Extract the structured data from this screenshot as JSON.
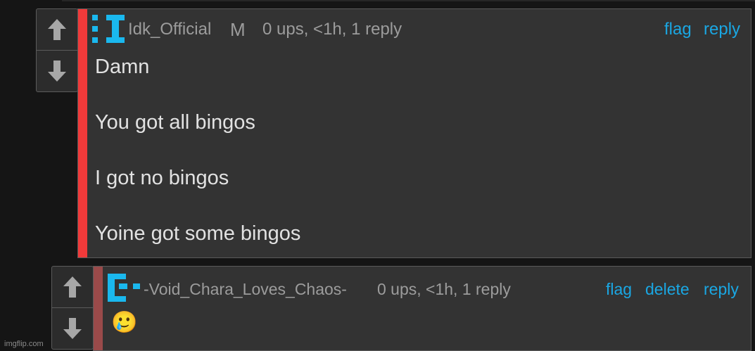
{
  "comments": [
    {
      "username": "Idk_Official",
      "badge": "M",
      "stats": "0 ups, <1h, 1 reply",
      "actions": {
        "flag": "flag",
        "reply": "reply"
      },
      "body": [
        "Damn",
        "You got all bingos",
        "I got no bingos",
        "Yoine got some bingos"
      ],
      "accent_color": "#f03a3a"
    },
    {
      "username": "-Void_Chara_Loves_Chaos-",
      "stats": "0 ups, <1h, 1 reply",
      "actions": {
        "flag": "flag",
        "delete": "delete",
        "reply": "reply"
      },
      "body": [
        "🥲"
      ],
      "accent_color": "#9a4a4a"
    }
  ],
  "icons": {
    "upvote": "arrow-up-icon",
    "downvote": "arrow-down-icon",
    "avatar": "pixel-avatar-icon"
  },
  "colors": {
    "link": "#1aa7e3",
    "avatar": "#1ab8ee"
  },
  "watermark": "imgflip.com"
}
